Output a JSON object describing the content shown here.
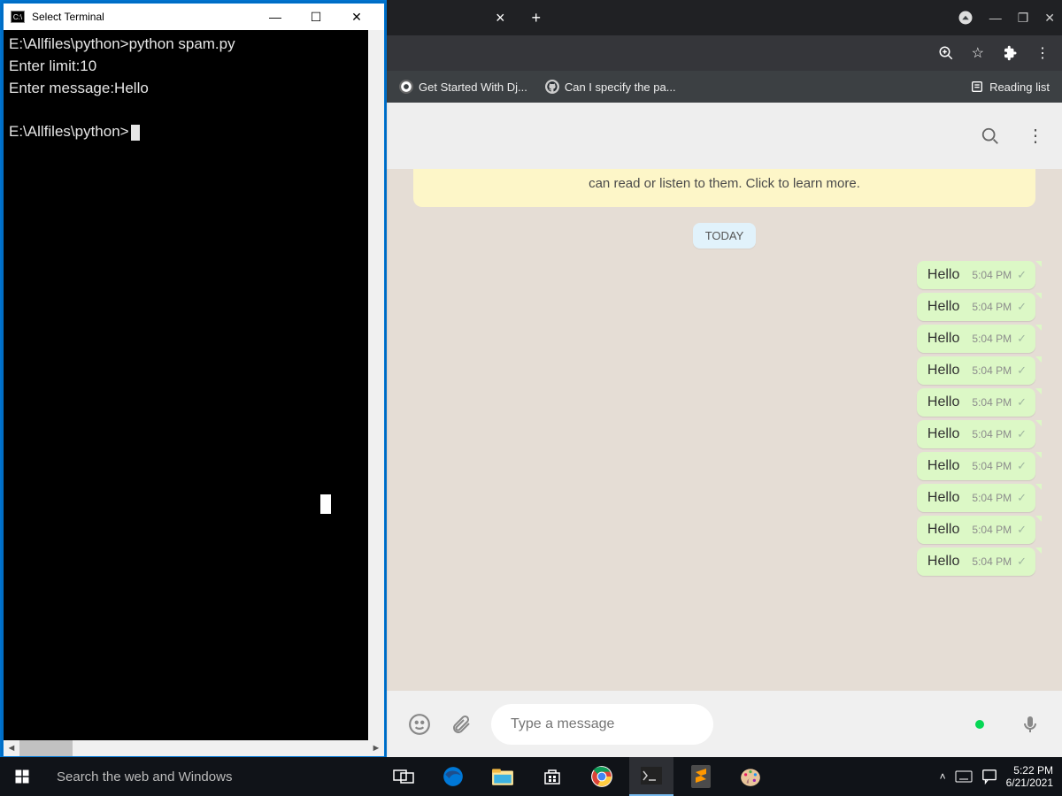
{
  "terminal": {
    "title": "Select Terminal",
    "lines": [
      "E:\\Allfiles\\python>python spam.py",
      "Enter limit:10",
      "Enter message:Hello",
      "",
      "E:\\Allfiles\\python>"
    ]
  },
  "browser": {
    "bookmarks": [
      {
        "icon": "⚙",
        "label": "Get Started With Dj..."
      },
      {
        "icon": "gh",
        "label": "Can I specify the pa..."
      }
    ],
    "reading_list": "Reading list"
  },
  "chat": {
    "encryption_notice": "can read or listen to them. Click to learn more.",
    "date_label": "TODAY",
    "messages": [
      {
        "text": "Hello",
        "time": "5:04 PM"
      },
      {
        "text": "Hello",
        "time": "5:04 PM"
      },
      {
        "text": "Hello",
        "time": "5:04 PM"
      },
      {
        "text": "Hello",
        "time": "5:04 PM"
      },
      {
        "text": "Hello",
        "time": "5:04 PM"
      },
      {
        "text": "Hello",
        "time": "5:04 PM"
      },
      {
        "text": "Hello",
        "time": "5:04 PM"
      },
      {
        "text": "Hello",
        "time": "5:04 PM"
      },
      {
        "text": "Hello",
        "time": "5:04 PM"
      },
      {
        "text": "Hello",
        "time": "5:04 PM"
      }
    ],
    "input_placeholder": "Type a message"
  },
  "taskbar": {
    "search_placeholder": "Search the web and Windows",
    "clock_time": "5:22 PM",
    "clock_date": "6/21/2021"
  }
}
